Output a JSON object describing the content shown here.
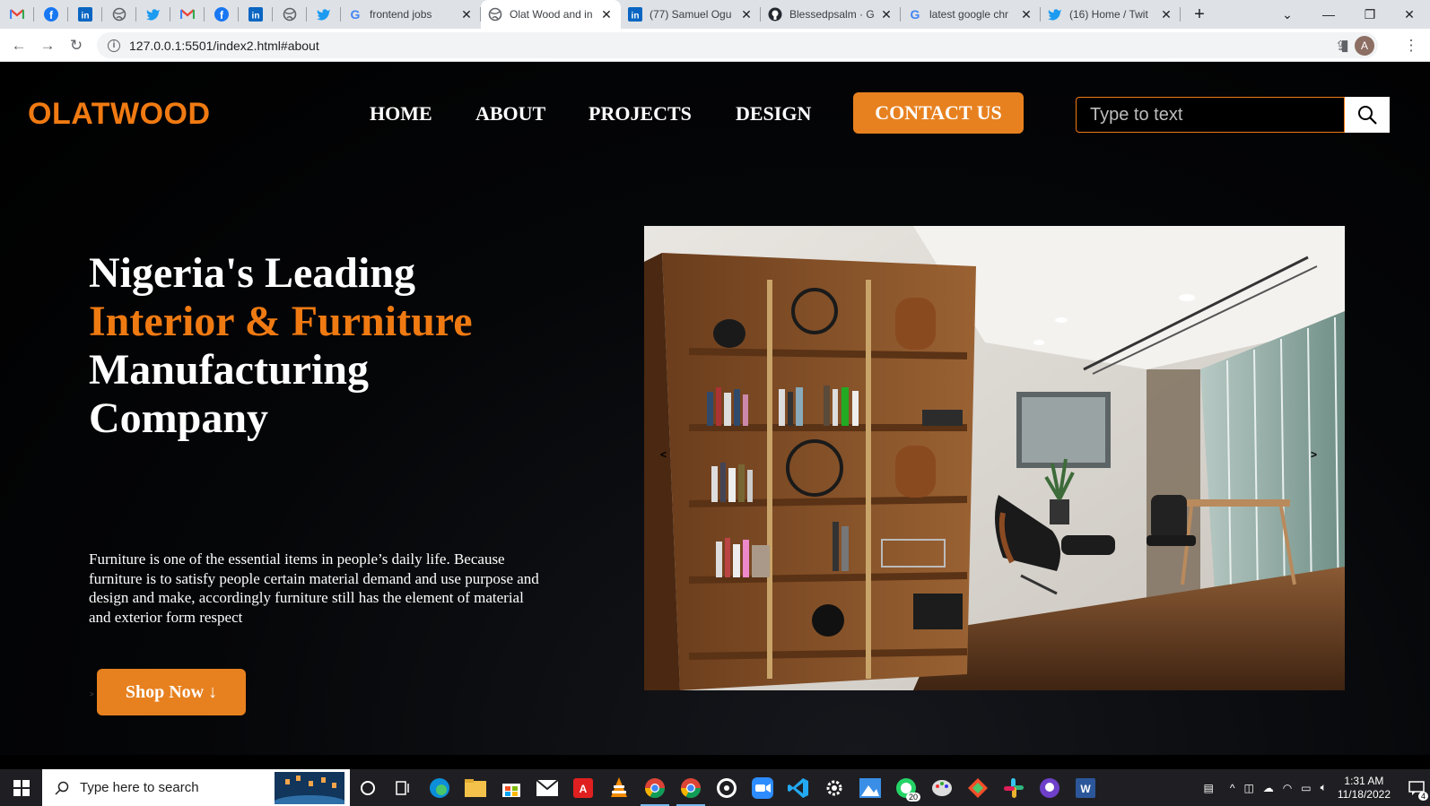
{
  "browser": {
    "pinned_tabs": [
      "gmail-icon",
      "facebook-icon",
      "linkedin-icon",
      "globe-icon",
      "twitter-icon",
      "gmail-icon",
      "facebook-icon",
      "linkedin-icon",
      "globe-icon",
      "twitter-icon"
    ],
    "tabs": [
      {
        "title": "frontend jobs",
        "icon": "google-icon",
        "active": false
      },
      {
        "title": "Olat Wood and in",
        "icon": "globe-icon",
        "active": true
      },
      {
        "title": "(77) Samuel Ogu",
        "icon": "linkedin-icon",
        "active": false
      },
      {
        "title": "Blessedpsalm · G",
        "icon": "github-icon",
        "active": false
      },
      {
        "title": "latest google chr",
        "icon": "google-icon",
        "active": false
      },
      {
        "title": "(16) Home / Twit",
        "icon": "twitter-icon",
        "active": false
      }
    ],
    "url": "127.0.0.1:5501/index2.html#about",
    "profile_initial": "A"
  },
  "site": {
    "logo": "OLATWOOD",
    "nav": {
      "home": "HOME",
      "about": "ABOUT",
      "projects": "PROJECTS",
      "design": "DESIGN"
    },
    "contact_label": "CONTACT US",
    "search_placeholder": "Type to text",
    "hero": {
      "line1": "Nigeria's Leading",
      "line2": "Interior & Furniture",
      "line3": "Manufacturing",
      "line4": "Company",
      "description": "Furniture is one of the essential items in people’s daily life. Because furniture is to satisfy people certain material demand and use purpose and design and make, accordingly furniture still has the element of material and exterior form respect",
      "shop_label": "Shop Now ↓",
      "slider_prev": "<",
      "slider_next": ">"
    },
    "colors": {
      "accent": "#f07a12",
      "button": "#e7811f",
      "background": "#000000"
    }
  },
  "taskbar": {
    "search_placeholder": "Type here to search",
    "time": "1:31 AM",
    "date": "11/18/2022",
    "notification_count": "4",
    "whatsapp_badge": "20"
  }
}
